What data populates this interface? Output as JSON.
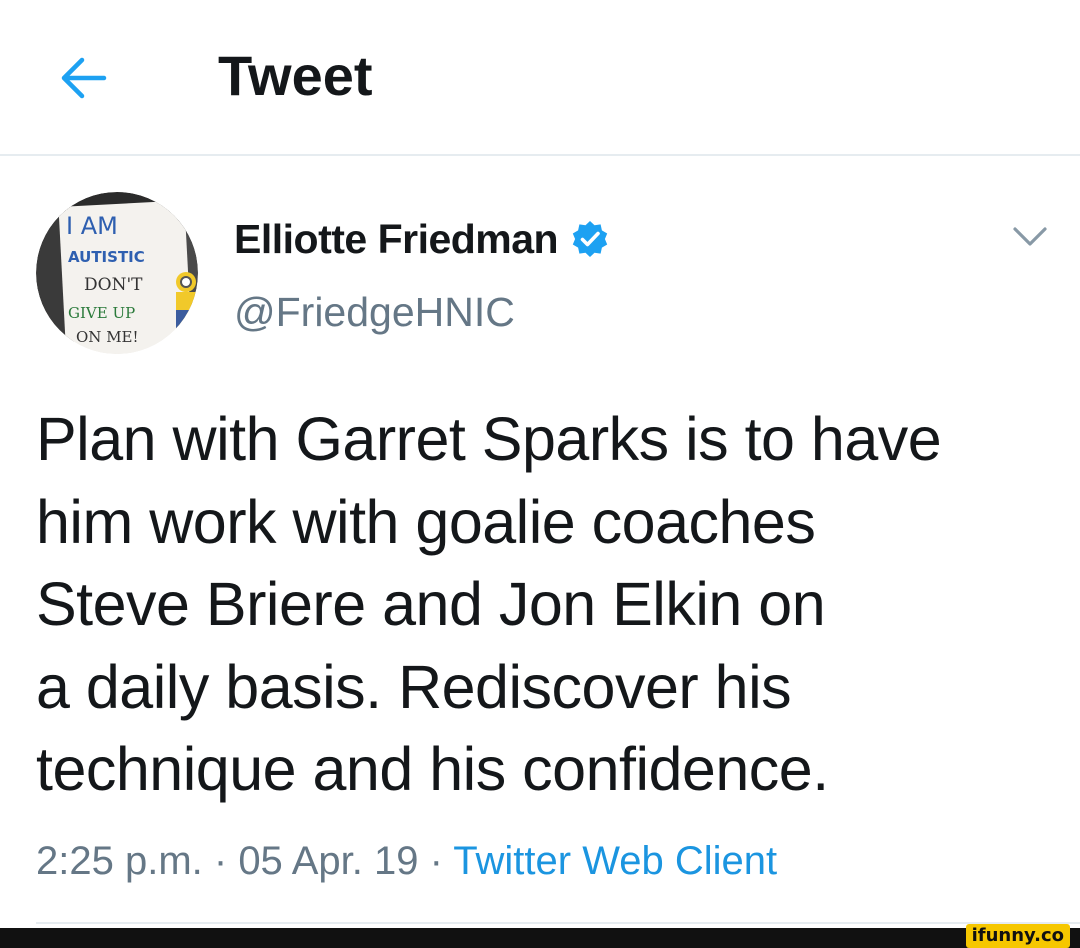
{
  "header": {
    "title": "Tweet",
    "back_icon": "arrow-left-icon",
    "accent_color": "#1da1f2"
  },
  "author": {
    "display_name": "Elliotte Friedman",
    "handle": "@FriedgeHNIC",
    "verified": true,
    "verified_icon": "verified-badge-icon",
    "avatar_sign": {
      "line1": "I AM",
      "line2": "AUTISTIC",
      "line3": "DON'T",
      "line4": "GIVE UP",
      "line5": "ON ME!"
    },
    "menu_icon": "chevron-down-icon"
  },
  "tweet": {
    "lines": [
      "Plan with Garret Sparks is to have",
      "him work with goalie coaches",
      "Steve Briere and Jon Elkin on",
      "a daily basis. Rediscover his",
      "technique and his confidence."
    ]
  },
  "meta": {
    "time": "2:25 p.m.",
    "separator": " · ",
    "date": "05 Apr. 19",
    "source": "Twitter Web Client"
  },
  "watermark": {
    "text": "ifunny.co"
  },
  "colors": {
    "text_primary": "#14171a",
    "text_secondary": "#657786",
    "link": "#1b95e0",
    "divider": "#e6ecf0"
  }
}
